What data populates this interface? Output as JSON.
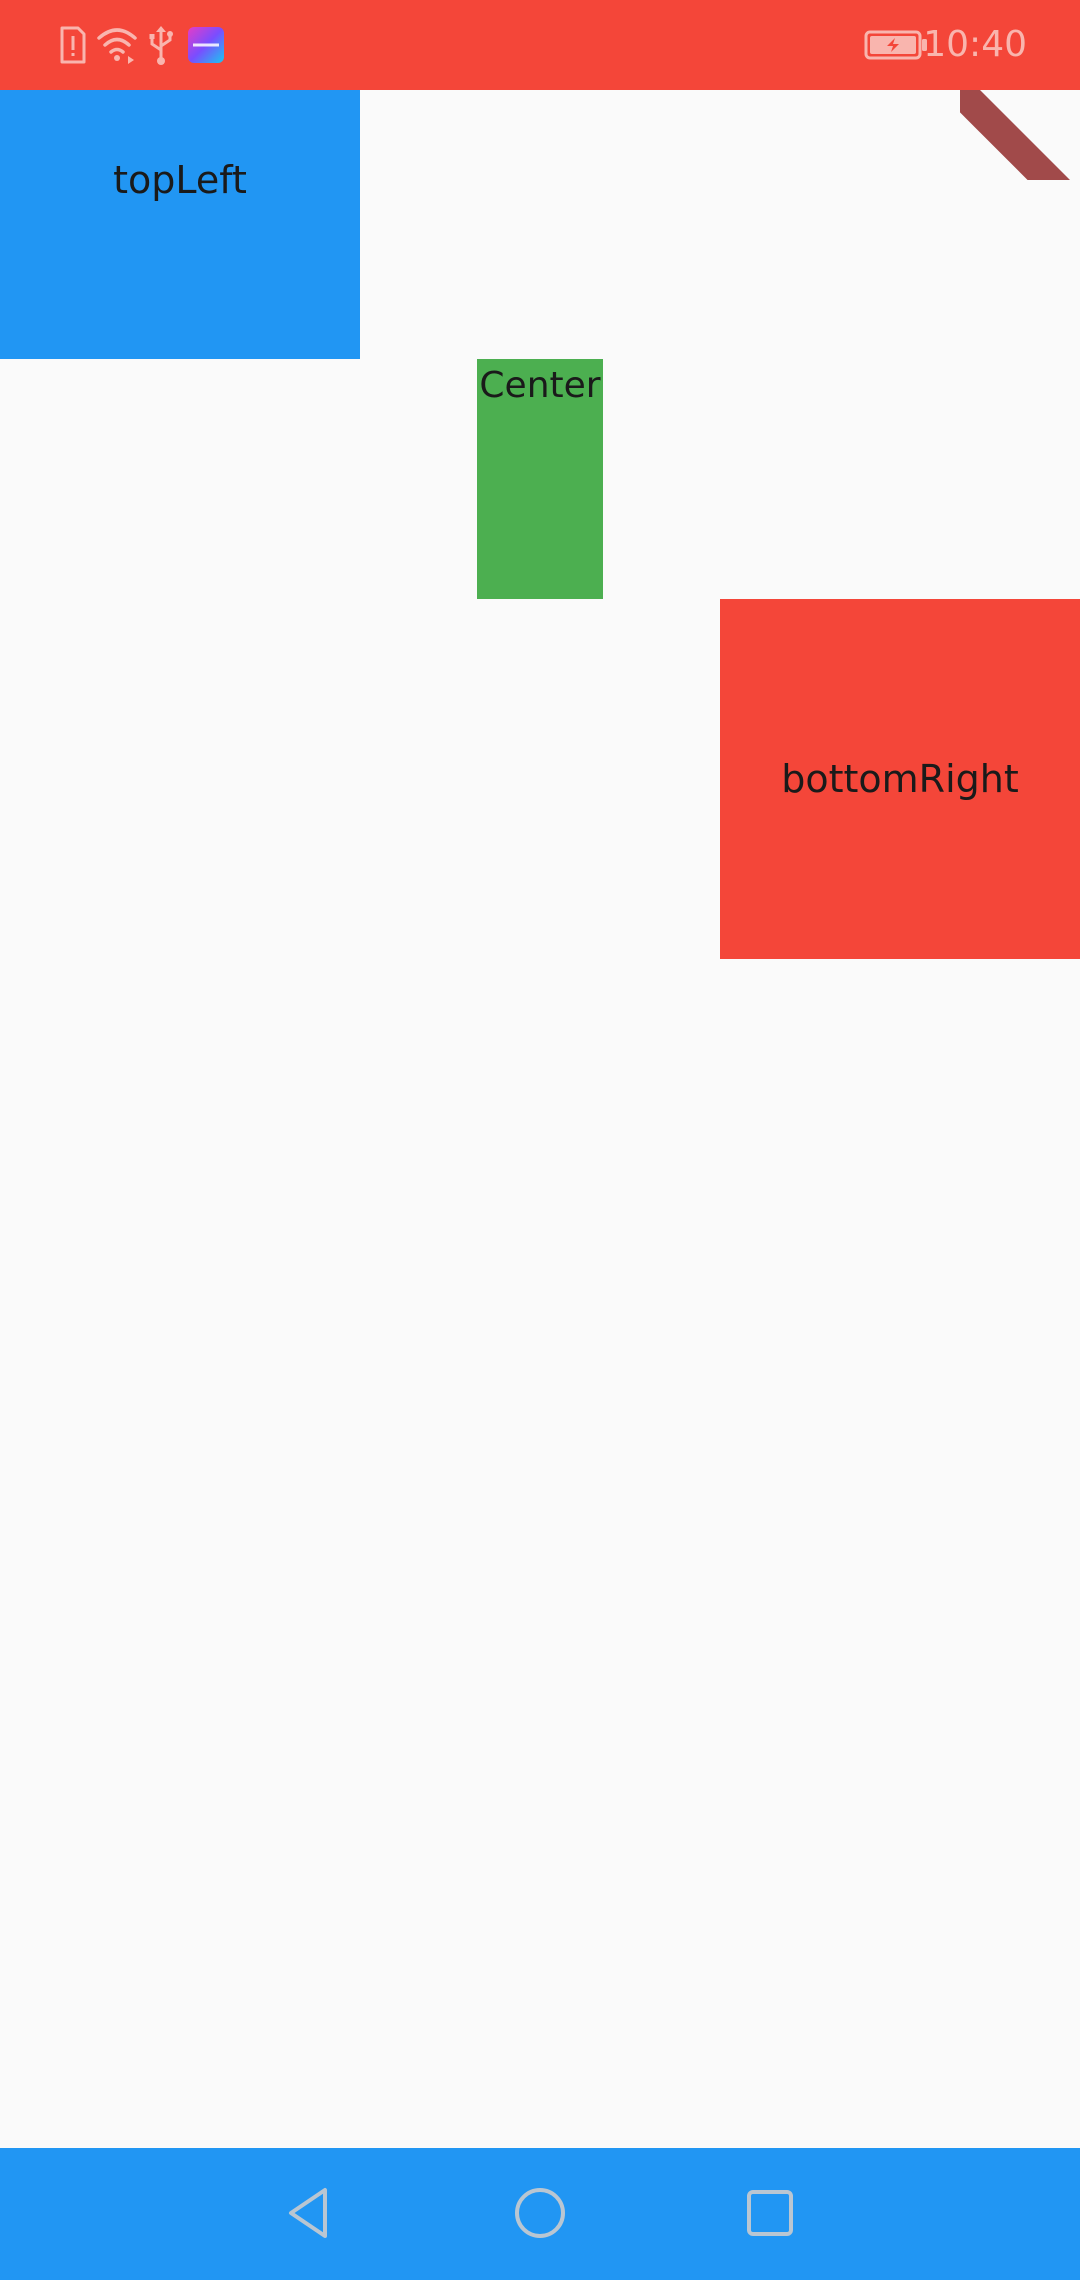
{
  "status_bar": {
    "time": "10:40",
    "background": "#f44639",
    "icons": [
      "sim-alert-icon",
      "wifi-icon",
      "usb-icon",
      "honor-app-icon",
      "battery-charging-icon"
    ]
  },
  "boxes": {
    "top_left": {
      "label": "topLeft",
      "color": "#2196f3"
    },
    "center": {
      "label": "Center",
      "color": "#4caf50"
    },
    "bottom_right": {
      "label": "bottomRight",
      "color": "#f44639"
    }
  },
  "debug_ribbon": {
    "color": "#a14a4a"
  },
  "nav_bar": {
    "background": "#2196f3",
    "buttons": [
      "back-icon",
      "home-icon",
      "recents-icon"
    ]
  }
}
